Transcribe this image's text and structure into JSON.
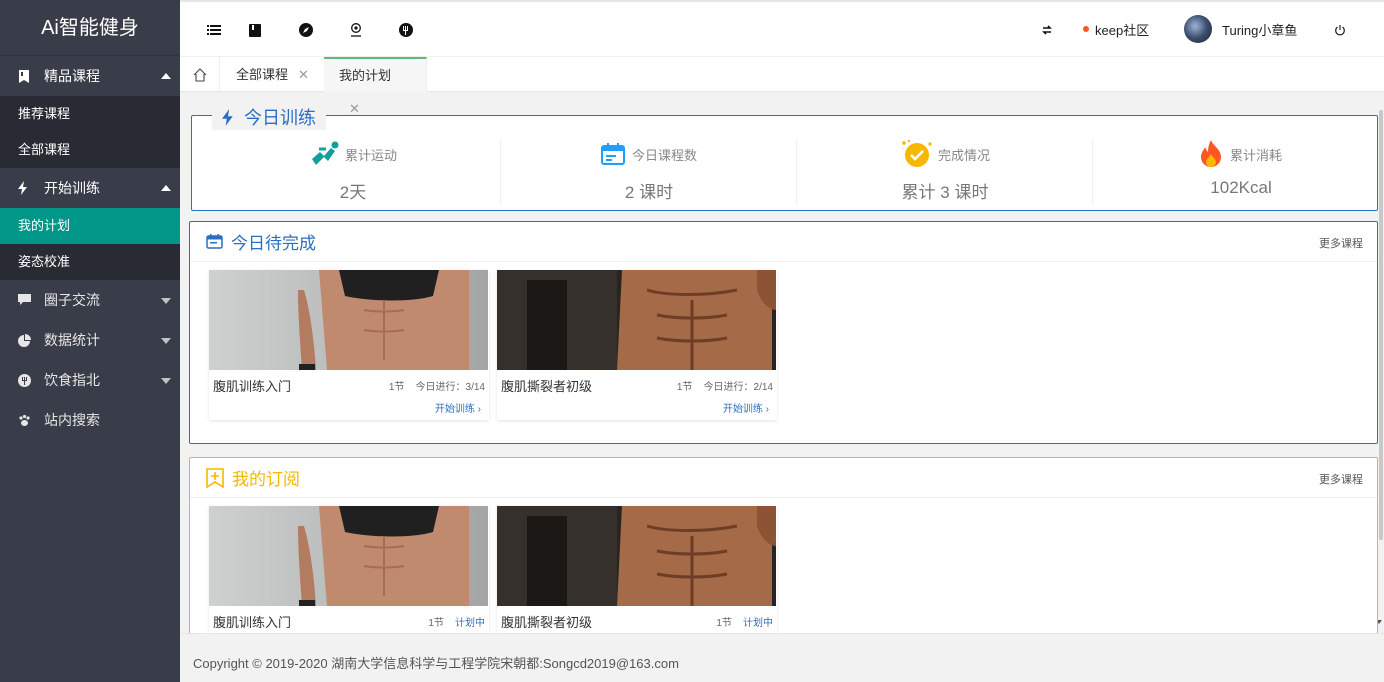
{
  "app": {
    "title": "Ai智能健身"
  },
  "sidebar": {
    "groups": [
      {
        "label": "精品课程",
        "expanded": true,
        "items": [
          "推荐课程",
          "全部课程"
        ]
      },
      {
        "label": "开始训练",
        "expanded": true,
        "items": [
          "我的计划",
          "姿态校准"
        ],
        "active_item": "我的计划"
      },
      {
        "label": "圈子交流",
        "expanded": false
      },
      {
        "label": "数据统计",
        "expanded": false
      },
      {
        "label": "饮食指北",
        "expanded": false
      },
      {
        "label": "站内搜索"
      }
    ]
  },
  "header": {
    "tools": [
      "menu-icon",
      "bookmark-icon",
      "compass-icon",
      "location-icon",
      "fork-icon"
    ],
    "refresh_icon": "refresh-icon",
    "community": "keep社区",
    "username": "Turing小章鱼",
    "power_icon": "power-icon"
  },
  "tabs": [
    {
      "label": "全部课程",
      "active": false
    },
    {
      "label": "我的计划",
      "active": true
    }
  ],
  "today": {
    "title": "今日训练",
    "stats": [
      {
        "label": "累计运动",
        "value": "2天",
        "icon": "running-icon"
      },
      {
        "label": "今日课程数",
        "value": "2 课时",
        "icon": "calendar-icon"
      },
      {
        "label": "完成情况",
        "value": "累计 3 课时",
        "icon": "check-badge-icon"
      },
      {
        "label": "累计消耗",
        "value": "102Kcal",
        "icon": "flame-icon"
      }
    ]
  },
  "todo": {
    "title": "今日待完成",
    "more": "更多课程",
    "courses": [
      {
        "title": "腹肌训练入门",
        "sections": "1节",
        "progress": "今日进行：3/14",
        "action": "开始训练 ›"
      },
      {
        "title": "腹肌撕裂者初级",
        "sections": "1节",
        "progress": "今日进行：2/14",
        "action": "开始训练 ›"
      }
    ]
  },
  "subscribed": {
    "title": "我的订阅",
    "more": "更多课程",
    "courses": [
      {
        "title": "腹肌训练入门",
        "sections": "1节",
        "status": "计划中"
      },
      {
        "title": "腹肌撕裂者初级",
        "sections": "1节",
        "status": "计划中"
      }
    ]
  },
  "footer": {
    "text": "Copyright © 2019-2020 湖南大学信息科学与工程学院宋朝都:Songcd2019@163.com"
  },
  "colors": {
    "primary": "#009688",
    "blue": "#2b6fc2",
    "orange": "#f5b800",
    "sidebar": "#393d49",
    "sub": "#282b33"
  }
}
